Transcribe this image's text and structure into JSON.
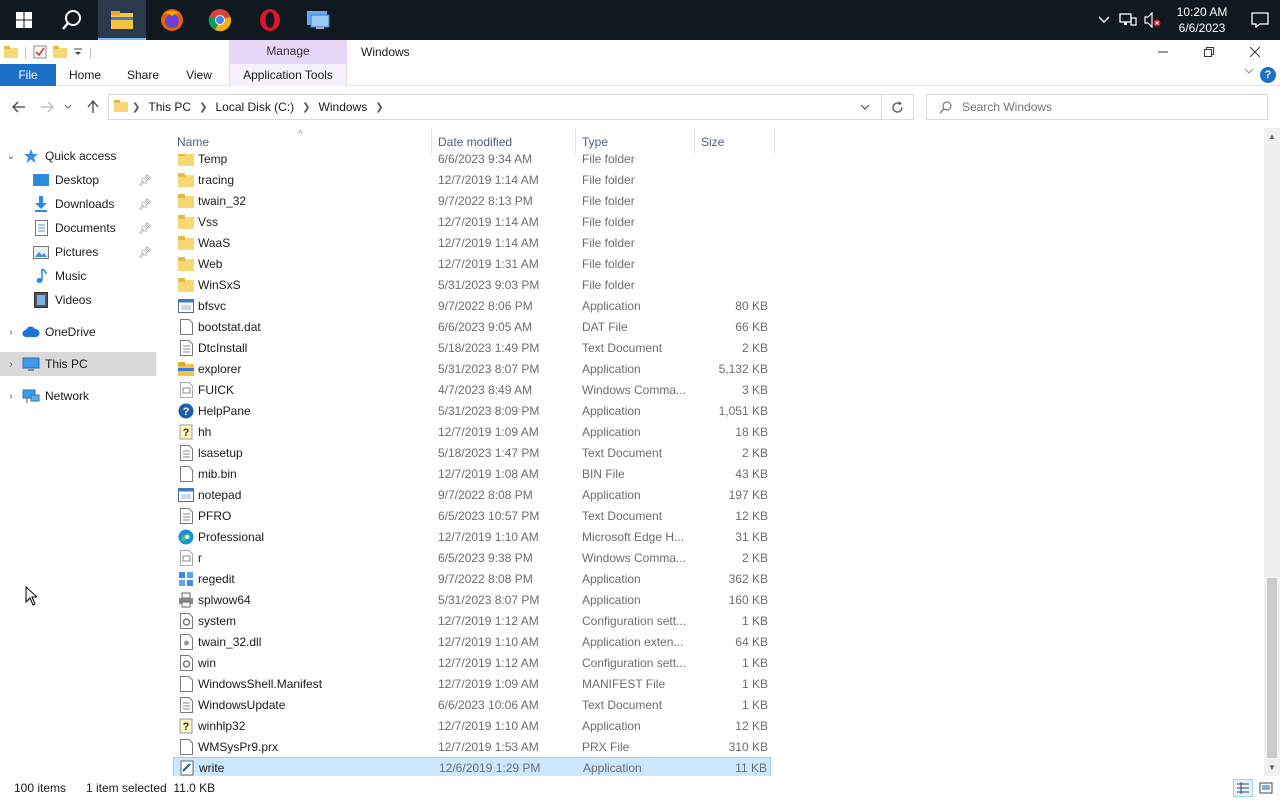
{
  "taskbar": {
    "apps": [
      {
        "name": "start-button",
        "icon": "windows-logo-icon"
      },
      {
        "name": "search-button",
        "icon": "search-icon"
      },
      {
        "name": "file-explorer",
        "icon": "folder-icon",
        "active": true
      },
      {
        "name": "firefox",
        "icon": "firefox-icon"
      },
      {
        "name": "chrome",
        "icon": "chrome-icon"
      },
      {
        "name": "opera",
        "icon": "opera-icon"
      },
      {
        "name": "remote-desktop",
        "icon": "monitor-icon"
      }
    ],
    "clock_time": "10:20 AM",
    "clock_date": "6/6/2023"
  },
  "window": {
    "title": "Windows",
    "context_tab": "Manage"
  },
  "ribbon": {
    "file": "File",
    "home": "Home",
    "share": "Share",
    "view": "View",
    "app_tools": "Application Tools",
    "help": "?"
  },
  "address": {
    "crumbs": [
      "This PC",
      "Local Disk (C:)",
      "Windows"
    ],
    "search_placeholder": "Search Windows"
  },
  "sidebar": {
    "quick_access": "Quick access",
    "items": [
      {
        "label": "Desktop",
        "pinned": true
      },
      {
        "label": "Downloads",
        "pinned": true
      },
      {
        "label": "Documents",
        "pinned": true
      },
      {
        "label": "Pictures",
        "pinned": true
      },
      {
        "label": "Music"
      },
      {
        "label": "Videos"
      }
    ],
    "onedrive": "OneDrive",
    "this_pc": "This PC",
    "network": "Network"
  },
  "columns": {
    "name": "Name",
    "date": "Date modified",
    "type": "Type",
    "size": "Size"
  },
  "files": [
    {
      "name": "Temp",
      "date": "6/6/2023 9:34 AM",
      "type": "File folder",
      "size": "",
      "icon": "folder"
    },
    {
      "name": "tracing",
      "date": "12/7/2019 1:14 AM",
      "type": "File folder",
      "size": "",
      "icon": "folder"
    },
    {
      "name": "twain_32",
      "date": "9/7/2022 8:13 PM",
      "type": "File folder",
      "size": "",
      "icon": "folder"
    },
    {
      "name": "Vss",
      "date": "12/7/2019 1:14 AM",
      "type": "File folder",
      "size": "",
      "icon": "folder"
    },
    {
      "name": "WaaS",
      "date": "12/7/2019 1:14 AM",
      "type": "File folder",
      "size": "",
      "icon": "folder"
    },
    {
      "name": "Web",
      "date": "12/7/2019 1:31 AM",
      "type": "File folder",
      "size": "",
      "icon": "folder"
    },
    {
      "name": "WinSxS",
      "date": "5/31/2023 9:03 PM",
      "type": "File folder",
      "size": "",
      "icon": "folder"
    },
    {
      "name": "bfsvc",
      "date": "9/7/2022 8:06 PM",
      "type": "Application",
      "size": "80 KB",
      "icon": "app"
    },
    {
      "name": "bootstat.dat",
      "date": "6/6/2023 9:05 AM",
      "type": "DAT File",
      "size": "66 KB",
      "icon": "file"
    },
    {
      "name": "DtcInstall",
      "date": "5/18/2023 1:49 PM",
      "type": "Text Document",
      "size": "2 KB",
      "icon": "text"
    },
    {
      "name": "explorer",
      "date": "5/31/2023 8:07 PM",
      "type": "Application",
      "size": "5,132 KB",
      "icon": "explorer"
    },
    {
      "name": "FUICK",
      "date": "4/7/2023 8:49 AM",
      "type": "Windows Comma...",
      "size": "3 KB",
      "icon": "cmd"
    },
    {
      "name": "HelpPane",
      "date": "5/31/2023 8:09 PM",
      "type": "Application",
      "size": "1,051 KB",
      "icon": "help"
    },
    {
      "name": "hh",
      "date": "12/7/2019 1:09 AM",
      "type": "Application",
      "size": "18 KB",
      "icon": "hh"
    },
    {
      "name": "lsasetup",
      "date": "5/18/2023 1:47 PM",
      "type": "Text Document",
      "size": "2 KB",
      "icon": "text"
    },
    {
      "name": "mib.bin",
      "date": "12/7/2019 1:08 AM",
      "type": "BIN File",
      "size": "43 KB",
      "icon": "file"
    },
    {
      "name": "notepad",
      "date": "9/7/2022 8:08 PM",
      "type": "Application",
      "size": "197 KB",
      "icon": "app"
    },
    {
      "name": "PFRO",
      "date": "6/5/2023 10:57 PM",
      "type": "Text Document",
      "size": "12 KB",
      "icon": "text"
    },
    {
      "name": "Professional",
      "date": "12/7/2019 1:10 AM",
      "type": "Microsoft Edge H...",
      "size": "31 KB",
      "icon": "edge"
    },
    {
      "name": "r",
      "date": "6/5/2023 9:38 PM",
      "type": "Windows Comma...",
      "size": "2 KB",
      "icon": "cmd"
    },
    {
      "name": "regedit",
      "date": "9/7/2022 8:08 PM",
      "type": "Application",
      "size": "362 KB",
      "icon": "regedit"
    },
    {
      "name": "splwow64",
      "date": "5/31/2023 8:07 PM",
      "type": "Application",
      "size": "160 KB",
      "icon": "printer"
    },
    {
      "name": "system",
      "date": "12/7/2019 1:12 AM",
      "type": "Configuration sett...",
      "size": "1 KB",
      "icon": "config"
    },
    {
      "name": "twain_32.dll",
      "date": "12/7/2019 1:10 AM",
      "type": "Application exten...",
      "size": "64 KB",
      "icon": "dll"
    },
    {
      "name": "win",
      "date": "12/7/2019 1:12 AM",
      "type": "Configuration sett...",
      "size": "1 KB",
      "icon": "config"
    },
    {
      "name": "WindowsShell.Manifest",
      "date": "12/7/2019 1:09 AM",
      "type": "MANIFEST File",
      "size": "1 KB",
      "icon": "file"
    },
    {
      "name": "WindowsUpdate",
      "date": "6/6/2023 10:06 AM",
      "type": "Text Document",
      "size": "1 KB",
      "icon": "text"
    },
    {
      "name": "winhlp32",
      "date": "12/7/2019 1:10 AM",
      "type": "Application",
      "size": "12 KB",
      "icon": "hh"
    },
    {
      "name": "WMSysPr9.prx",
      "date": "12/7/2019 1:53 AM",
      "type": "PRX File",
      "size": "310 KB",
      "icon": "file"
    },
    {
      "name": "write",
      "date": "12/6/2019 1:29 PM",
      "type": "Application",
      "size": "11 KB",
      "icon": "write",
      "selected": true
    }
  ],
  "status": {
    "count": "100 items",
    "selection": "1 item selected  11.0 KB"
  },
  "colors": {
    "accent": "#1a6fc7",
    "selection": "#cce8ff",
    "folder": "#f8d775"
  }
}
